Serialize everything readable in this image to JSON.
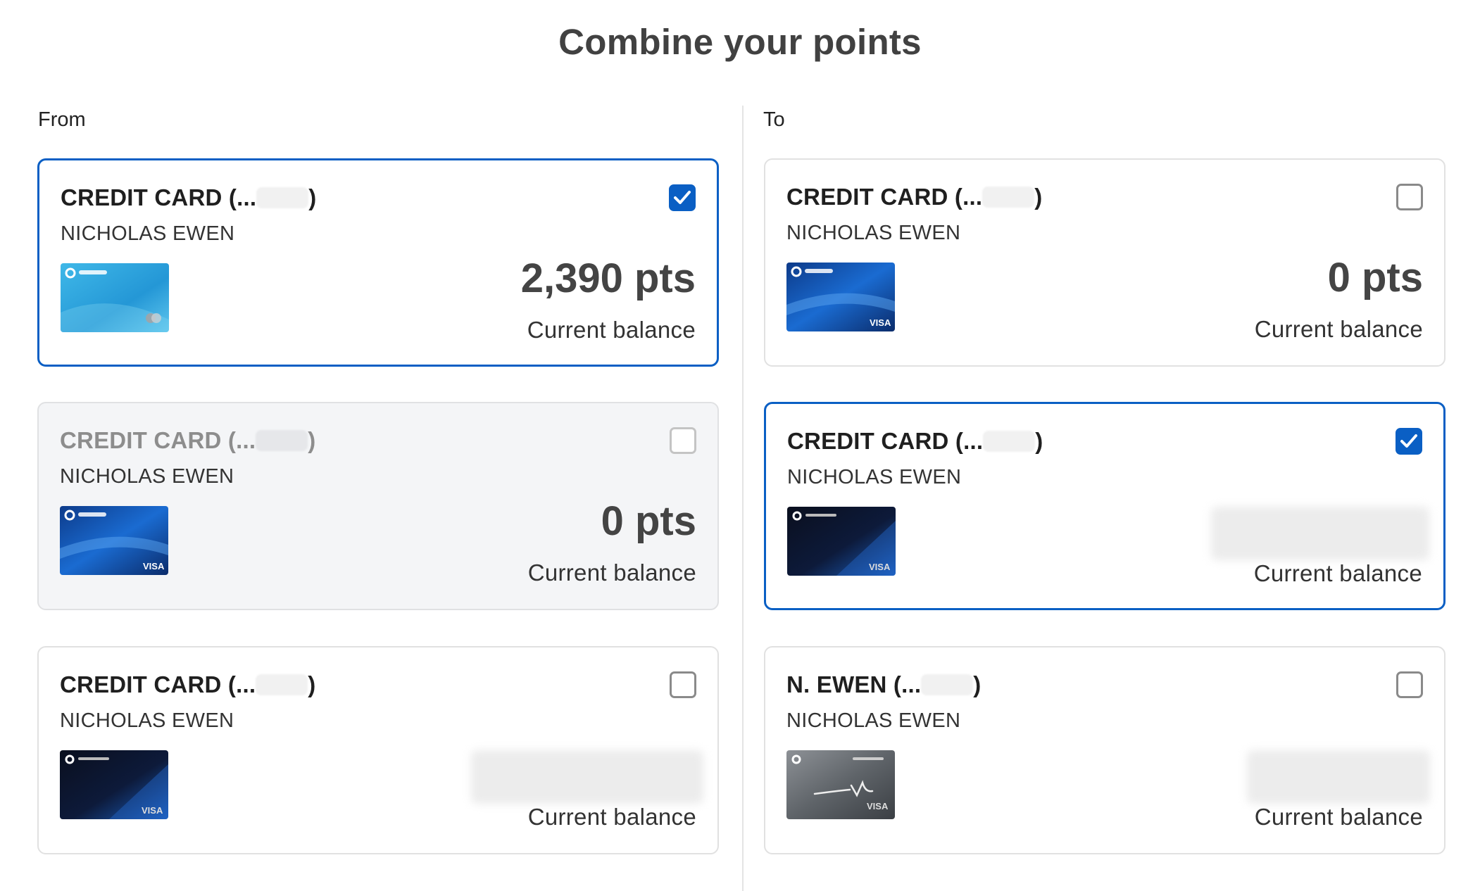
{
  "page": {
    "title": "Combine your points",
    "from_label": "From",
    "to_label": "To"
  },
  "colors": {
    "accent": "#0a5fc4",
    "disabled_bg": "#f4f5f7"
  },
  "from_cards": [
    {
      "name": "CREDIT CARD (...",
      "name_suffix": ")",
      "holder": "NICHOLAS EWEN",
      "points": "2,390 pts",
      "balance_label": "Current balance",
      "checked": true,
      "disabled": false,
      "card_art": "freedom-flex"
    },
    {
      "name": "CREDIT CARD (...",
      "name_suffix": ")",
      "holder": "NICHOLAS EWEN",
      "points": "0 pts",
      "balance_label": "Current balance",
      "checked": false,
      "disabled": true,
      "card_art": "freedom-unlimited"
    },
    {
      "name": "CREDIT CARD (...",
      "name_suffix": ")",
      "holder": "NICHOLAS EWEN",
      "points": "",
      "balance_label": "Current balance",
      "checked": false,
      "disabled": false,
      "card_art": "sapphire-preferred"
    }
  ],
  "to_cards": [
    {
      "name": "CREDIT CARD (...",
      "name_suffix": ")",
      "holder": "NICHOLAS EWEN",
      "points": "0 pts",
      "balance_label": "Current balance",
      "checked": false,
      "disabled": false,
      "card_art": "freedom-unlimited"
    },
    {
      "name": "CREDIT CARD (...",
      "name_suffix": ")",
      "holder": "NICHOLAS EWEN",
      "points": "",
      "balance_label": "Current balance",
      "checked": true,
      "disabled": false,
      "card_art": "sapphire-preferred"
    },
    {
      "name": "N. EWEN (...",
      "name_suffix": ")",
      "holder": "NICHOLAS EWEN",
      "points": "",
      "balance_label": "Current balance",
      "checked": false,
      "disabled": false,
      "card_art": "ink-business"
    }
  ]
}
